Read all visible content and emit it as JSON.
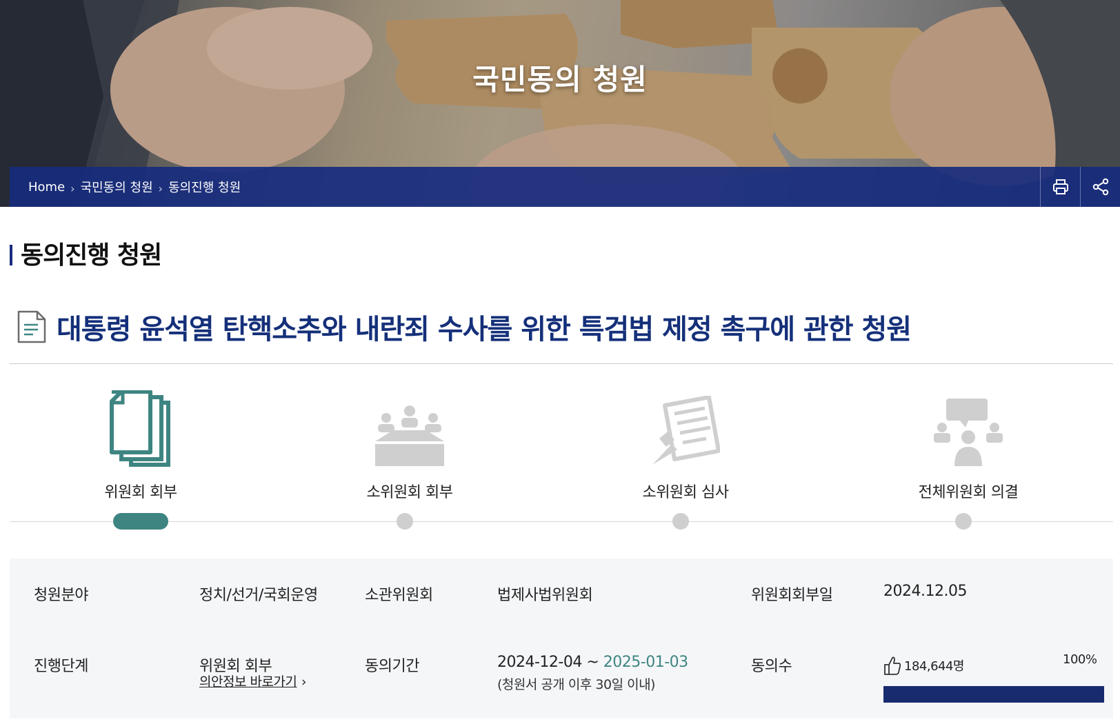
{
  "hero": {
    "title": "국민동의 청원"
  },
  "breadcrumb": {
    "items": [
      "Home",
      "국민동의 청원",
      "동의진행 청원"
    ]
  },
  "toolbar": {
    "print_icon": "printer-icon",
    "share_icon": "share-icon"
  },
  "section": {
    "title": "동의진행 청원"
  },
  "petition": {
    "title": "대통령 윤석열 탄핵소추와 내란죄 수사를 위한 특검법 제정 촉구에 관한 청원",
    "icon": "document-icon"
  },
  "steps": {
    "active_index": 0,
    "items": [
      {
        "label": "위원회 회부",
        "icon": "stacked-documents-icon"
      },
      {
        "label": "소위원회 회부",
        "icon": "meeting-table-icon"
      },
      {
        "label": "소위원회 심사",
        "icon": "review-document-icon"
      },
      {
        "label": "전체위원회 의결",
        "icon": "discussion-group-icon"
      }
    ]
  },
  "info": {
    "field_label": "청원분야",
    "field_value": "정치/선거/국회운영",
    "committee_label": "소관위원회",
    "committee_value": "법제사법위원회",
    "referral_date_label": "위원회회부일",
    "referral_date_value": "2024.12.05",
    "stage_label": "진행단계",
    "stage_value": "위원회 회부",
    "stage_link": "의안정보 바로가기",
    "period_label": "동의기간",
    "period_start": "2024-12-04 ~ ",
    "period_end": "2025-01-03",
    "period_note": "(청원서 공개 이후 30일 이내)",
    "agree_label": "동의수",
    "agree_count": "184,644명",
    "agree_percent": "100%",
    "agree_ratio": 1.0
  },
  "colors": {
    "navy": "#172b7d",
    "title_blue": "#15307a",
    "teal": "#3e8582",
    "progress": "#172b6e"
  }
}
